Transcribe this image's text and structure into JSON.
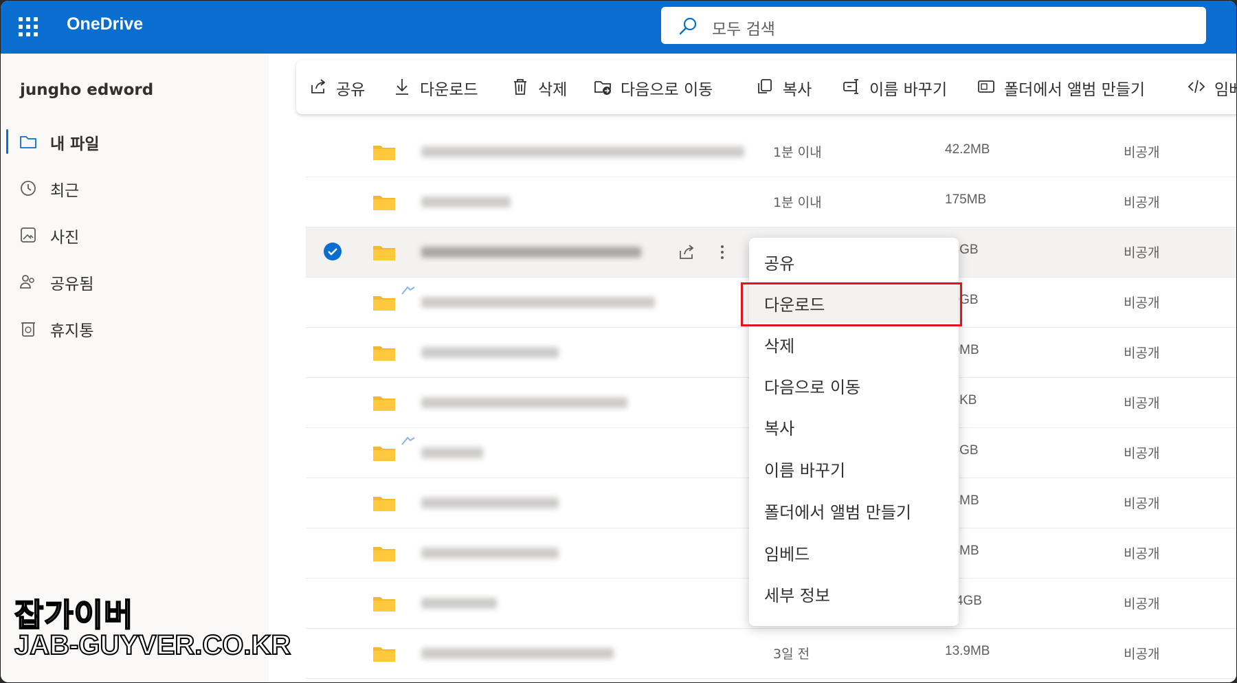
{
  "app": {
    "title": "OneDrive"
  },
  "search": {
    "placeholder": "모두 검색"
  },
  "sidebar": {
    "user": "jungho edword",
    "items": [
      {
        "label": "내 파일",
        "icon": "folder-icon",
        "active": true
      },
      {
        "label": "최근",
        "icon": "history-icon"
      },
      {
        "label": "사진",
        "icon": "photo-icon"
      },
      {
        "label": "공유됨",
        "icon": "people-icon"
      },
      {
        "label": "휴지통",
        "icon": "recycle-bin-icon"
      }
    ]
  },
  "toolbar": {
    "share": "공유",
    "download": "다운로드",
    "delete": "삭제",
    "move": "다음으로 이동",
    "copy": "복사",
    "rename": "이름 바꾸기",
    "album": "폴더에서 앨범 만들기",
    "embed": "임베"
  },
  "files": [
    {
      "modified": "1분 이내",
      "size": "42.2MB",
      "sharing": "비공개"
    },
    {
      "modified": "1분 이내",
      "size": "175MB",
      "sharing": "비공개"
    },
    {
      "modified": "",
      "size": "98GB",
      "sharing": "비공개",
      "selected": true
    },
    {
      "modified": "",
      "size": "39GB",
      "sharing": "비공개"
    },
    {
      "modified": "",
      "size": "70MB",
      "sharing": "비공개"
    },
    {
      "modified": "",
      "size": "43KB",
      "sharing": "비공개"
    },
    {
      "modified": "",
      "size": "26GB",
      "sharing": "비공개"
    },
    {
      "modified": "",
      "size": "14MB",
      "sharing": "비공개"
    },
    {
      "modified": "",
      "size": "13MB",
      "sharing": "비공개"
    },
    {
      "modified": "",
      "size": "2.4GB",
      "sharing": "비공개"
    },
    {
      "modified": "3일 전",
      "size": "13.9MB",
      "sharing": "비공개"
    }
  ],
  "context_menu": {
    "items": [
      "공유",
      "다운로드",
      "삭제",
      "다음으로 이동",
      "복사",
      "이름 바꾸기",
      "폴더에서 앨범 만들기",
      "임베드",
      "세부 정보"
    ],
    "highlighted": "다운로드"
  },
  "watermark": {
    "line1": "잡가이버",
    "line2": "JAB-GUYVER.CO.KR"
  },
  "colors": {
    "accent": "#0a6ed1",
    "folder": "#f5b731",
    "highlight_box": "#e0141b"
  }
}
